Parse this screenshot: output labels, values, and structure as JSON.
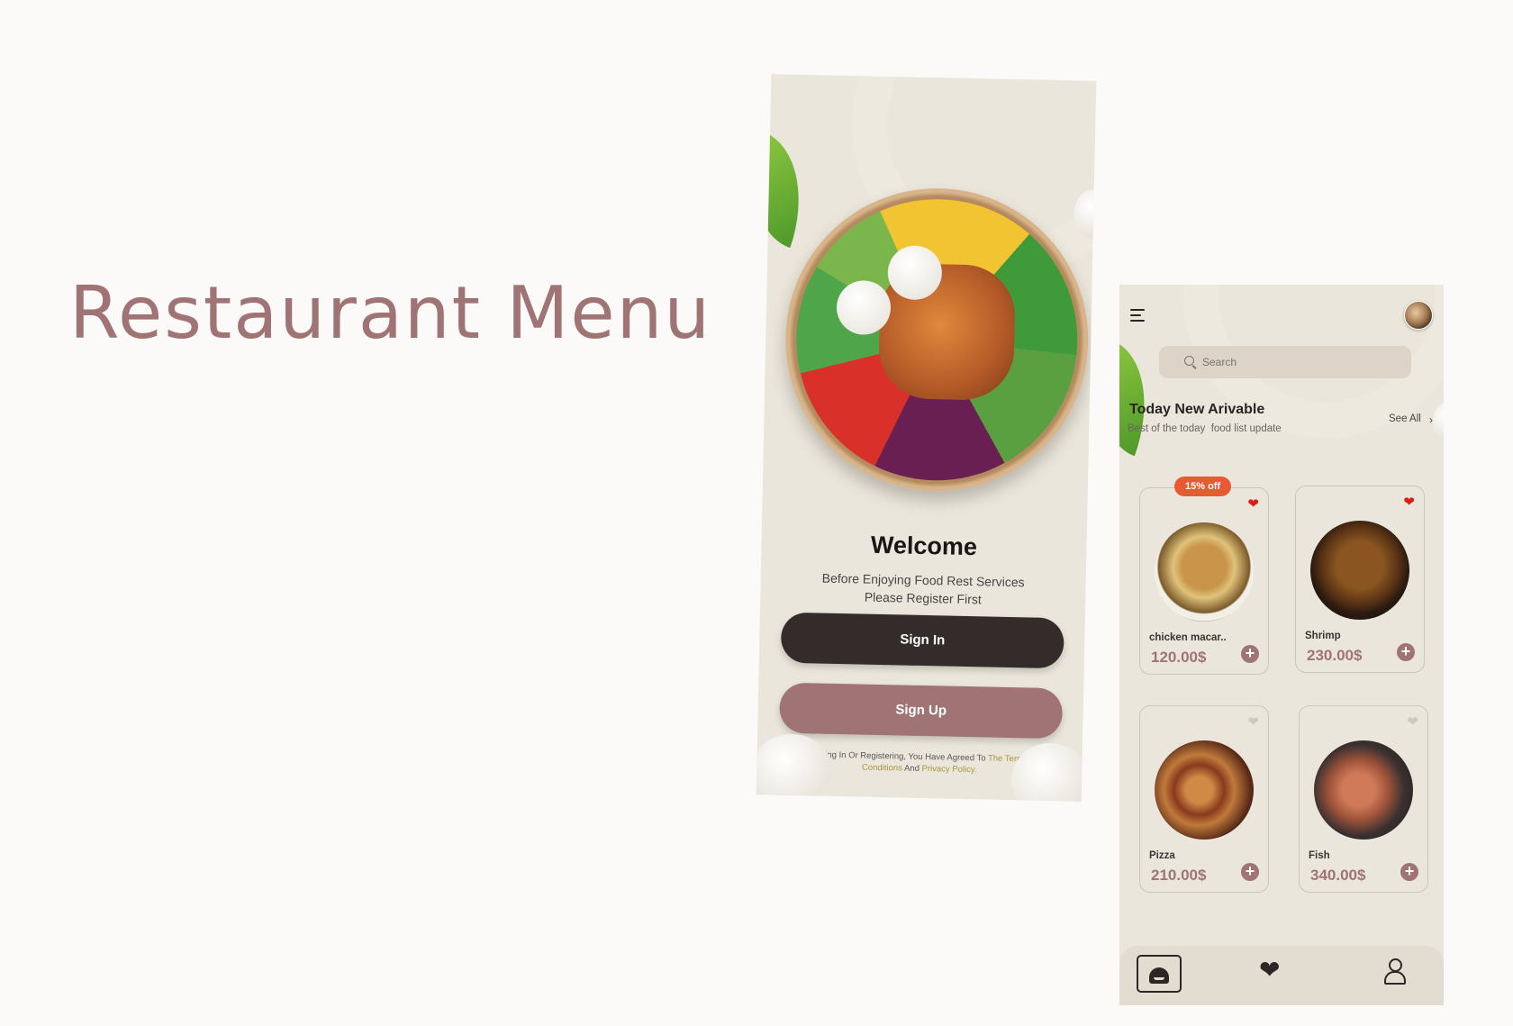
{
  "hero": {
    "title": "Restaurant Menu"
  },
  "welcome": {
    "title": "Welcome",
    "subtitle_line1": "Before Enjoying Food Rest Services",
    "subtitle_line2": "Please Register First",
    "sign_in_label": "Sign In",
    "sign_up_label": "Sign Up",
    "legal_prefix": "By Logging In Or Registering, You Have Agreed To",
    "terms_link": "The Terms And Conditions",
    "legal_and": "And",
    "privacy_link": "Privacy Policy."
  },
  "menu": {
    "search": {
      "placeholder": "Search"
    },
    "section_title": "Today New Arivable",
    "section_subtitle": "Best of the today  food list update",
    "see_all_label": "See All",
    "items": [
      {
        "name": "chicken macar..",
        "price": "120.00$",
        "badge": "15% off",
        "favorite": true
      },
      {
        "name": "Shrimp",
        "price": "230.00$",
        "favorite": true
      },
      {
        "name": "Pizza",
        "price": "210.00$",
        "favorite": false
      },
      {
        "name": "Fish",
        "price": "340.00$",
        "favorite": false
      }
    ]
  },
  "colors": {
    "brand": "#a07474",
    "dark": "#362b2b",
    "background": "#ebe6db",
    "badge": "#e85a30",
    "favorite": "#e11919"
  },
  "icons": [
    "menu-icon",
    "search-icon",
    "heart-icon",
    "plus-icon",
    "home-icon",
    "user-icon",
    "chevron-right-icon"
  ]
}
